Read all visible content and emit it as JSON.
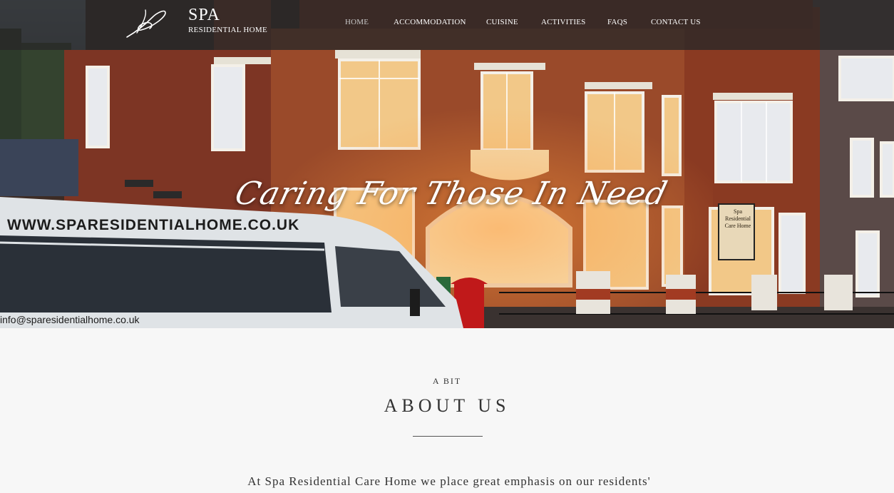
{
  "brand": {
    "name": "SPA",
    "subtitle": "RESIDENTIAL HOME",
    "logo_icon": "signature-logo-icon"
  },
  "nav": {
    "items": [
      {
        "label": "HOME",
        "active": true
      },
      {
        "label": "ACCOMMODATION",
        "active": false
      },
      {
        "label": "CUISINE",
        "active": false
      },
      {
        "label": "ACTIVITIES",
        "active": false
      },
      {
        "label": "FAQS",
        "active": false
      },
      {
        "label": "CONTACT US",
        "active": false
      }
    ]
  },
  "hero": {
    "tagline": "Caring For Those In Need",
    "van_url": "WWW.SPARESIDENTIALHOME.CO.UK",
    "van_email": "info@sparesidentialhome.co.uk",
    "sign_text": "Spa Residential Care Home"
  },
  "about": {
    "kicker": "A BIT",
    "title": "ABOUT US",
    "intro": "At Spa Residential Care Home we place great emphasis on our residents'"
  },
  "colors": {
    "nav_bg": "#282828",
    "page_bg": "#f7f7f7",
    "brick": "#8a3a22",
    "window_glow": "#f2a64c",
    "van_white": "#dfe3e6",
    "postbox_red": "#c0191a",
    "text_dark": "#333333"
  }
}
